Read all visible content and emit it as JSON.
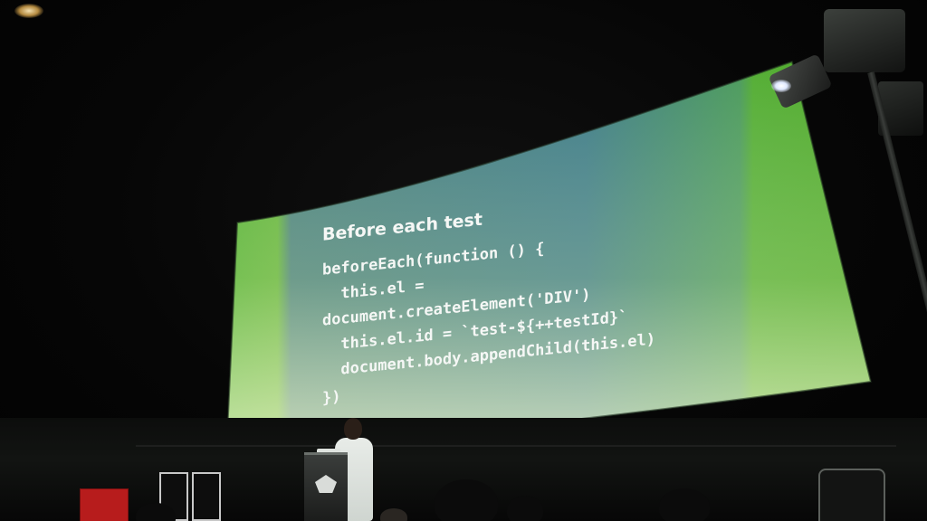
{
  "slide": {
    "heading": "Before each test",
    "code_lines": [
      "beforeEach(function () {",
      "  this.el =",
      "document.createElement('DIV')",
      "  this.el.id = `test-${++testId}`",
      "  document.body.appendChild(this.el)",
      "})"
    ]
  },
  "colors": {
    "slide_green": "#4caf2e",
    "slide_teal": "#3f7f86",
    "slide_light": "#d5e9a8",
    "code_white": "#f5f7f5",
    "code_keyword": "#e3c9ff",
    "stage_dark": "#060606"
  },
  "icons": {
    "podium_logo": "podium-logo-icon",
    "stage_light": "stage-light-icon"
  }
}
